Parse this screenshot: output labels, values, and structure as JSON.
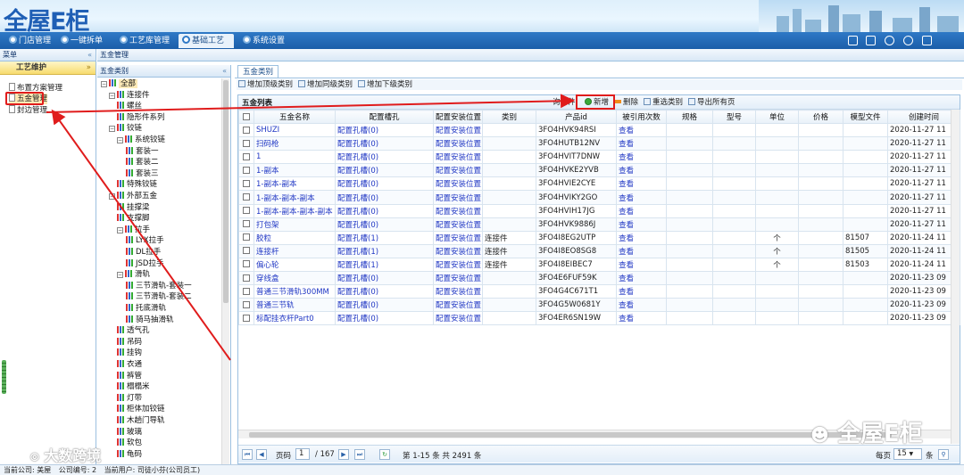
{
  "app": {
    "logo_text": "全屋E柜"
  },
  "nav": {
    "tabs": [
      {
        "label": "门店管理",
        "active": false
      },
      {
        "label": "一键拆单",
        "active": false
      },
      {
        "label": "工艺库管理",
        "active": false
      },
      {
        "label": "基础工艺",
        "active": true
      },
      {
        "label": "系统设置",
        "active": false
      }
    ]
  },
  "left_panel": {
    "title": "菜单",
    "category": "工艺维护",
    "items": [
      {
        "label": "布置方案管理",
        "selected": false
      },
      {
        "label": "五金管理",
        "selected": true
      },
      {
        "label": "封边管理",
        "selected": false
      }
    ]
  },
  "tree_panel": {
    "breadcrumb": "五金管理",
    "title": "五金类别",
    "nodes": [
      {
        "label": "全部",
        "level": 0,
        "toggle": "−"
      },
      {
        "label": "连接件",
        "level": 1,
        "toggle": "−"
      },
      {
        "label": "螺丝",
        "level": 2,
        "toggle": ""
      },
      {
        "label": "隐形件系列",
        "level": 2,
        "toggle": ""
      },
      {
        "label": "铰链",
        "level": 1,
        "toggle": "−"
      },
      {
        "label": "系统铰链",
        "level": 2,
        "toggle": "−"
      },
      {
        "label": "套装一",
        "level": 3,
        "toggle": ""
      },
      {
        "label": "套装二",
        "level": 3,
        "toggle": ""
      },
      {
        "label": "套装三",
        "level": 3,
        "toggle": ""
      },
      {
        "label": "特殊铰链",
        "level": 2,
        "toggle": ""
      },
      {
        "label": "外部五金",
        "level": 1,
        "toggle": "−"
      },
      {
        "label": "挂撑梁",
        "level": 2,
        "toggle": ""
      },
      {
        "label": "支撑脚",
        "level": 2,
        "toggle": ""
      },
      {
        "label": "拉手",
        "level": 2,
        "toggle": "−"
      },
      {
        "label": "LYX拉手",
        "level": 3,
        "toggle": ""
      },
      {
        "label": "DL拉手",
        "level": 3,
        "toggle": ""
      },
      {
        "label": "JSD拉手",
        "level": 3,
        "toggle": ""
      },
      {
        "label": "滑轨",
        "level": 2,
        "toggle": "−"
      },
      {
        "label": "三节滑轨-套装一",
        "level": 3,
        "toggle": ""
      },
      {
        "label": "三节滑轨-套装二",
        "level": 3,
        "toggle": ""
      },
      {
        "label": "托底滑轨",
        "level": 3,
        "toggle": ""
      },
      {
        "label": "骑马抽滑轨",
        "level": 3,
        "toggle": ""
      },
      {
        "label": "透气孔",
        "level": 2,
        "toggle": ""
      },
      {
        "label": "吊码",
        "level": 2,
        "toggle": ""
      },
      {
        "label": "挂钩",
        "level": 2,
        "toggle": ""
      },
      {
        "label": "衣通",
        "level": 2,
        "toggle": ""
      },
      {
        "label": "裤管",
        "level": 2,
        "toggle": ""
      },
      {
        "label": "榻榻米",
        "level": 2,
        "toggle": ""
      },
      {
        "label": "灯带",
        "level": 2,
        "toggle": ""
      },
      {
        "label": "柜体加铰链",
        "level": 2,
        "toggle": ""
      },
      {
        "label": "木趟门导轨",
        "level": 2,
        "toggle": ""
      },
      {
        "label": "玻璃",
        "level": 2,
        "toggle": ""
      },
      {
        "label": "软包",
        "level": 2,
        "toggle": ""
      },
      {
        "label": "龟码",
        "level": 2,
        "toggle": ""
      }
    ]
  },
  "main": {
    "tab": "五金类别",
    "category_buttons": [
      "增加顶级类别",
      "增加同级类别",
      "增加下级类别"
    ],
    "list_title": "五金列表",
    "toolbar": {
      "query": "询条件",
      "add": "新增",
      "delete": "删除",
      "reselect": "重选类别",
      "export": "导出所有页"
    },
    "columns": [
      "五金名称",
      "配置槽孔",
      "配置安装位置",
      "类别",
      "产品id",
      "被引用次数",
      "规格",
      "型号",
      "单位",
      "价格",
      "模型文件",
      "创建时间"
    ],
    "rows": [
      {
        "name": "SHUZI",
        "slot": "配置孔槽(0)",
        "install": "配置安装位置",
        "category": "",
        "pid": "3FO4HVK94RSI",
        "ref": "查看",
        "spec": "",
        "model": "",
        "unit": "",
        "price": "",
        "file": "",
        "created": "2020-11-27 11"
      },
      {
        "name": "扫码枪",
        "slot": "配置孔槽(0)",
        "install": "配置安装位置",
        "category": "",
        "pid": "3FO4HUTB12NV",
        "ref": "查看",
        "spec": "",
        "model": "",
        "unit": "",
        "price": "",
        "file": "",
        "created": "2020-11-27 11"
      },
      {
        "name": "1",
        "slot": "配置孔槽(0)",
        "install": "配置安装位置",
        "category": "",
        "pid": "3FO4HVIT7DNW",
        "ref": "查看",
        "spec": "",
        "model": "",
        "unit": "",
        "price": "",
        "file": "",
        "created": "2020-11-27 11"
      },
      {
        "name": "1-副本",
        "slot": "配置孔槽(0)",
        "install": "配置安装位置",
        "category": "",
        "pid": "3FO4HVKE2YVB",
        "ref": "查看",
        "spec": "",
        "model": "",
        "unit": "",
        "price": "",
        "file": "",
        "created": "2020-11-27 11"
      },
      {
        "name": "1-副本-副本",
        "slot": "配置孔槽(0)",
        "install": "配置安装位置",
        "category": "",
        "pid": "3FO4HVIE2CYE",
        "ref": "查看",
        "spec": "",
        "model": "",
        "unit": "",
        "price": "",
        "file": "",
        "created": "2020-11-27 11"
      },
      {
        "name": "1-副本-副本-副本",
        "slot": "配置孔槽(0)",
        "install": "配置安装位置",
        "category": "",
        "pid": "3FO4HVIKY2GO",
        "ref": "查看",
        "spec": "",
        "model": "",
        "unit": "",
        "price": "",
        "file": "",
        "created": "2020-11-27 11"
      },
      {
        "name": "1-副本-副本-副本-副本",
        "slot": "配置孔槽(0)",
        "install": "配置安装位置",
        "category": "",
        "pid": "3FO4HVIH17JG",
        "ref": "查看",
        "spec": "",
        "model": "",
        "unit": "",
        "price": "",
        "file": "",
        "created": "2020-11-27 11"
      },
      {
        "name": "打包架",
        "slot": "配置孔槽(0)",
        "install": "配置安装位置",
        "category": "",
        "pid": "3FO4HVK9886J",
        "ref": "查看",
        "spec": "",
        "model": "",
        "unit": "",
        "price": "",
        "file": "",
        "created": "2020-11-27 11"
      },
      {
        "name": "胶粒",
        "slot": "配置孔槽(1)",
        "install": "配置安装位置",
        "category": "连接件",
        "pid": "3FO4I8EG2UTP",
        "ref": "查看",
        "spec": "",
        "model": "",
        "unit": "个",
        "price": "",
        "file": "81507",
        "created": "2020-11-24 11"
      },
      {
        "name": "连接杆",
        "slot": "配置孔槽(1)",
        "install": "配置安装位置",
        "category": "连接件",
        "pid": "3FO4I8EO8SG8",
        "ref": "查看",
        "spec": "",
        "model": "",
        "unit": "个",
        "price": "",
        "file": "81505",
        "created": "2020-11-24 11"
      },
      {
        "name": "偏心轮",
        "slot": "配置孔槽(1)",
        "install": "配置安装位置",
        "category": "连接件",
        "pid": "3FO4I8EIBEC7",
        "ref": "查看",
        "spec": "",
        "model": "",
        "unit": "个",
        "price": "",
        "file": "81503",
        "created": "2020-11-24 11"
      },
      {
        "name": "穿线盒",
        "slot": "配置孔槽(0)",
        "install": "配置安装位置",
        "category": "",
        "pid": "3FO4E6FUF59K",
        "ref": "查看",
        "spec": "",
        "model": "",
        "unit": "",
        "price": "",
        "file": "",
        "created": "2020-11-23 09"
      },
      {
        "name": "普通三节滑轨300MM",
        "slot": "配置孔槽(0)",
        "install": "配置安装位置",
        "category": "",
        "pid": "3FO4G4C671T1",
        "ref": "查看",
        "spec": "",
        "model": "",
        "unit": "",
        "price": "",
        "file": "",
        "created": "2020-11-23 09"
      },
      {
        "name": "普通三节轨",
        "slot": "配置孔槽(0)",
        "install": "配置安装位置",
        "category": "",
        "pid": "3FO4G5W0681Y",
        "ref": "查看",
        "spec": "",
        "model": "",
        "unit": "",
        "price": "",
        "file": "",
        "created": "2020-11-23 09"
      },
      {
        "name": "标配挂衣杆Part0",
        "slot": "配置孔槽(0)",
        "install": "配置安装位置",
        "category": "",
        "pid": "3FO4ER6SN19W",
        "ref": "查看",
        "spec": "",
        "model": "",
        "unit": "",
        "price": "",
        "file": "",
        "created": "2020-11-23 09"
      }
    ],
    "pager": {
      "page_label": "页码",
      "page_value": "1",
      "total_pages": "/ 167",
      "summary": "第 1-15 条  共 2491 条",
      "per_page_label": "每页",
      "per_page_value": "15",
      "per_page_unit": "条"
    }
  },
  "status": {
    "company": "当前公司: 美屋",
    "company_no": "公司编号: 2",
    "user": "当前用户: 司徒小芬(公司员工)"
  },
  "watermarks": {
    "left": "大数跨境",
    "right": "全屋E柜"
  },
  "colors": {
    "nav_bg": "#1b5ea9",
    "link": "#2037c4",
    "highlight": "#e01c1c"
  }
}
